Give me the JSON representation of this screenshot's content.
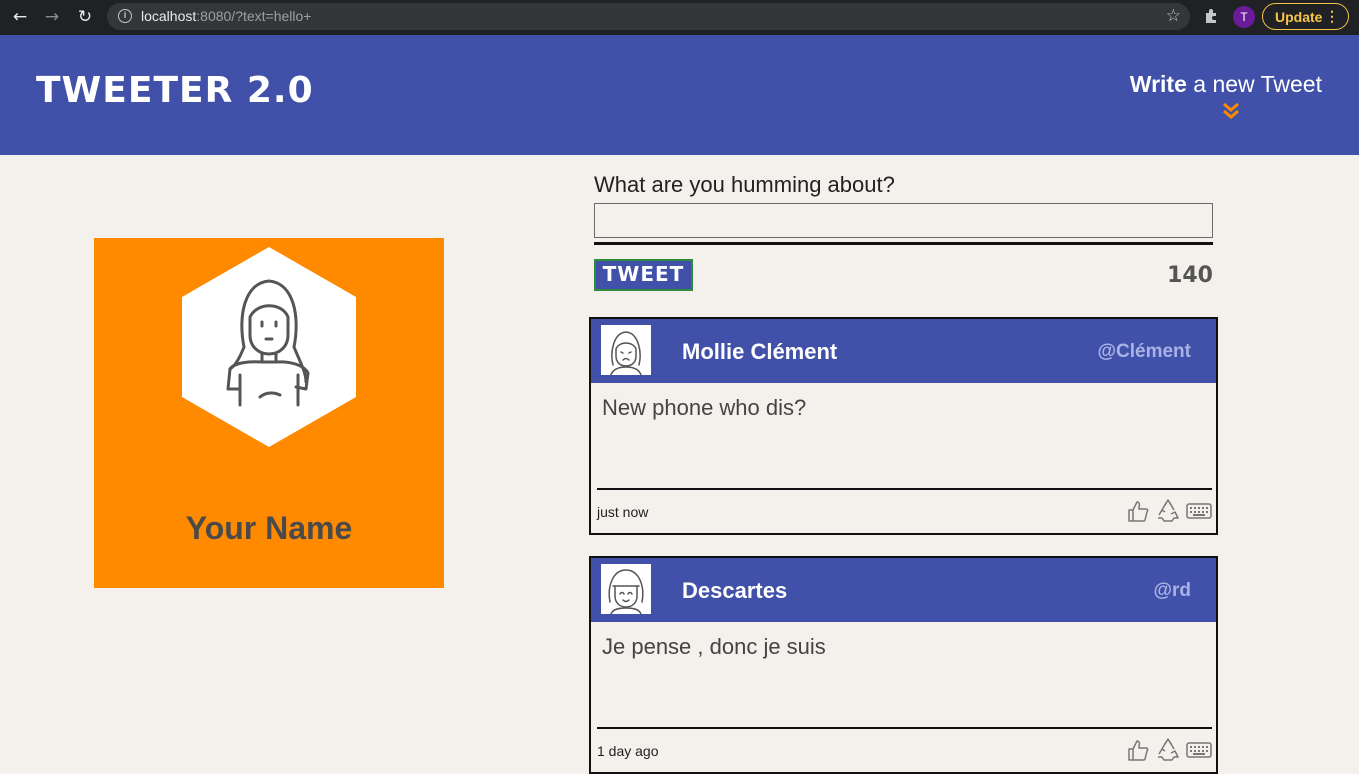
{
  "browser": {
    "url_host": "localhost",
    "url_rest": ":8080/?text=hello+",
    "profile_initial": "T",
    "update_label": "Update"
  },
  "header": {
    "logo": "TWEETER 2.0",
    "write_bold": "Write",
    "write_rest": " a new Tweet"
  },
  "profile": {
    "name": "Your Name"
  },
  "composer": {
    "label": "What are you humming about?",
    "value": "",
    "tweet_label": "TWEET",
    "counter": "140"
  },
  "tweets": [
    {
      "name": "Mollie Clément",
      "handle": "@Clément",
      "body": "New phone who dis?",
      "time": "just now"
    },
    {
      "name": "Descartes",
      "handle": "@rd",
      "body": "Je pense , donc je suis",
      "time": "1 day ago"
    }
  ],
  "colors": {
    "header_bg": "#4150a8",
    "accent_orange": "#ff8a00",
    "page_bg": "#f4f1ec"
  }
}
